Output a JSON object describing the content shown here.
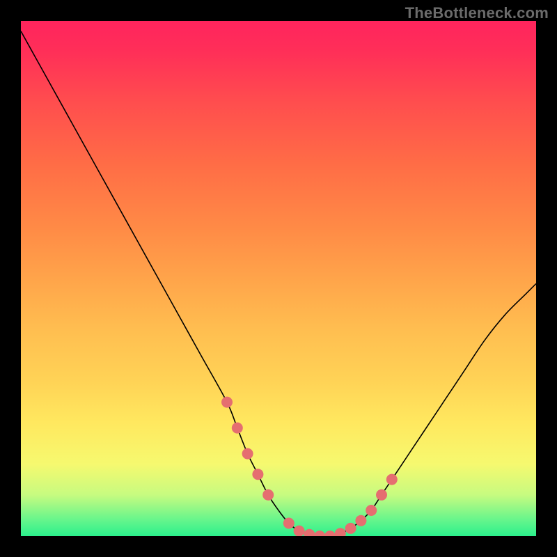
{
  "watermark": "TheBottleneck.com",
  "colors": {
    "background": "#000000",
    "gradient_top": "#ff245d",
    "gradient_mid": "#ffe85f",
    "gradient_bottom": "#2bf08c",
    "curve": "#000000",
    "beads": "#e56e70"
  },
  "chart_data": {
    "type": "line",
    "title": "",
    "xlabel": "",
    "ylabel": "",
    "xlim": [
      0,
      100
    ],
    "ylim": [
      0,
      100
    ],
    "x": [
      0,
      5,
      10,
      15,
      20,
      25,
      30,
      35,
      40,
      42,
      44,
      46,
      48,
      50,
      52,
      54,
      56,
      58,
      60,
      62,
      64,
      66,
      68,
      70,
      74,
      78,
      82,
      86,
      90,
      94,
      98,
      100
    ],
    "values": [
      98,
      89,
      80,
      71,
      62,
      53,
      44,
      35,
      26,
      21,
      16,
      12,
      8,
      5,
      2.5,
      1,
      0.3,
      0,
      0,
      0.5,
      1.5,
      3,
      5,
      8,
      14,
      20,
      26,
      32,
      38,
      43,
      47,
      49
    ],
    "bead_points": {
      "x": [
        40,
        42,
        44,
        46,
        48,
        52,
        54,
        56,
        58,
        60,
        62,
        64,
        66,
        68,
        70,
        72
      ],
      "y": [
        26,
        21,
        16,
        12,
        8,
        2.5,
        1,
        0.3,
        0,
        0,
        0.5,
        1.5,
        3,
        5,
        8,
        11
      ]
    },
    "annotations": [
      {
        "text": "TheBottleneck.com",
        "position": "top-right"
      }
    ]
  }
}
